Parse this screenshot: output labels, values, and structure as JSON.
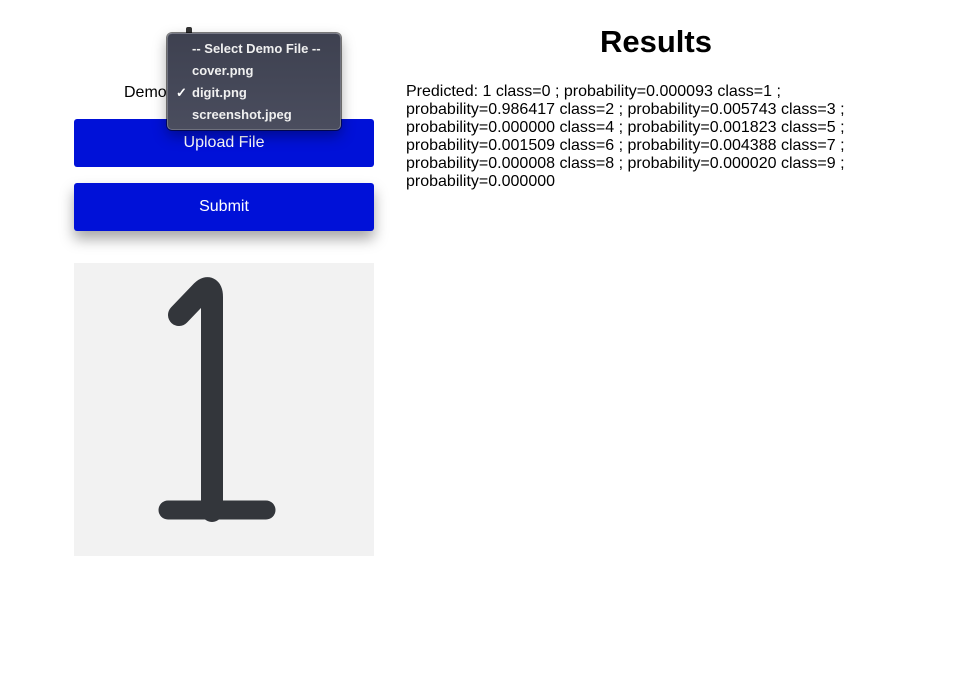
{
  "left": {
    "demo_label": "Demo",
    "upload_label": "Upload File",
    "submit_label": "Submit"
  },
  "dropdown": {
    "items": [
      {
        "label": "-- Select Demo File --",
        "selected": false
      },
      {
        "label": "cover.png",
        "selected": false
      },
      {
        "label": "digit.png",
        "selected": true
      },
      {
        "label": "screenshot.jpeg",
        "selected": false
      }
    ],
    "check_glyph": "✓"
  },
  "results": {
    "title": "Results",
    "text": "Predicted: 1 class=0 ; probability=0.000093 class=1 ; probability=0.986417 class=2 ; probability=0.005743 class=3 ; probability=0.000000 class=4 ; probability=0.001823 class=5 ; probability=0.001509 class=6 ; probability=0.004388 class=7 ; probability=0.000008 class=8 ; probability=0.000020 class=9 ; probability=0.000000"
  },
  "colors": {
    "button": "#0011d8",
    "preview_bg": "#f2f2f2",
    "digit_stroke": "#33363b"
  },
  "icons": {
    "preview": "digit-one-image"
  }
}
